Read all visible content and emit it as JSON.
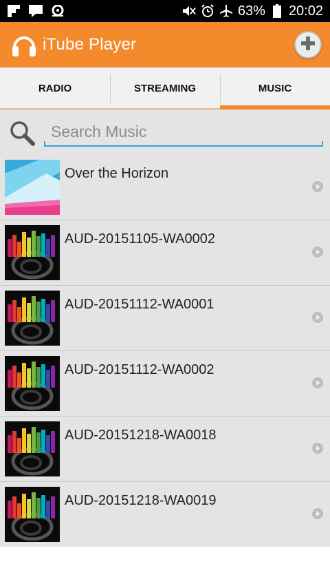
{
  "status_bar": {
    "battery": "63%",
    "time": "20:02",
    "icons": [
      "flipboard-icon",
      "message-icon",
      "location-icon",
      "mute-icon",
      "alarm-icon",
      "airplane-icon",
      "battery-icon"
    ]
  },
  "app_bar": {
    "title": "iTube Player",
    "logo_icon": "headphones-icon",
    "add_icon": "plus-icon",
    "color": "#f58a2d"
  },
  "tabs": [
    {
      "label": "RADIO",
      "active": false
    },
    {
      "label": "STREAMING",
      "active": false
    },
    {
      "label": "MUSIC",
      "active": true
    }
  ],
  "search": {
    "placeholder": "Search Music",
    "value": ""
  },
  "tracks": [
    {
      "title": "Over the Horizon",
      "art": "horizon-album-art"
    },
    {
      "title": "AUD-20151105-WA0002",
      "art": "equalizer-art"
    },
    {
      "title": "AUD-20151112-WA0001",
      "art": "equalizer-art"
    },
    {
      "title": "AUD-20151112-WA0002",
      "art": "equalizer-art"
    },
    {
      "title": "AUD-20151218-WA0018",
      "art": "equalizer-art"
    },
    {
      "title": "AUD-20151218-WA0019",
      "art": "equalizer-art"
    }
  ]
}
